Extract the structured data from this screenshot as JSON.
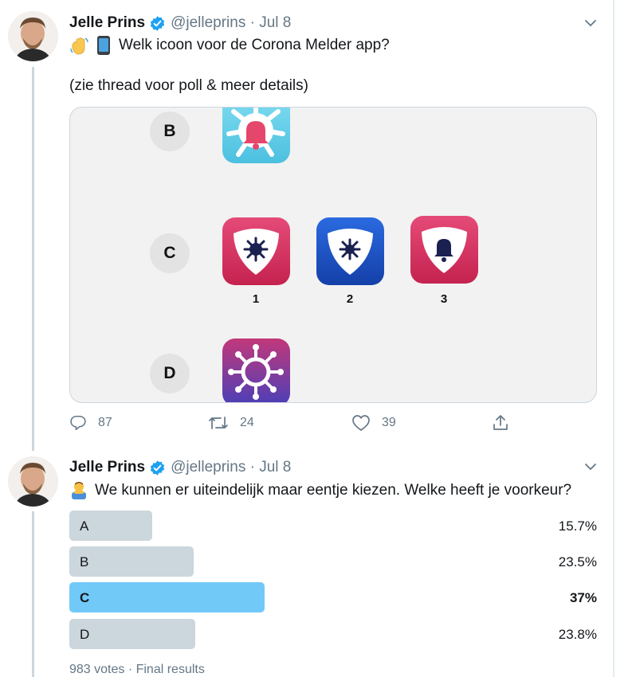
{
  "tweet1": {
    "author_name": "Jelle Prins",
    "handle": "@jelleprins",
    "date": "Jul 8",
    "text_line1": "Welk icoon voor de Corona Melder app?",
    "text_line2": "(zie thread voor poll & meer details)",
    "media": {
      "rows": [
        {
          "label": "B"
        },
        {
          "label": "C",
          "variants": [
            "1",
            "2",
            "3"
          ]
        },
        {
          "label": "D"
        }
      ]
    },
    "actions": {
      "replies": "87",
      "retweets": "24",
      "likes": "39"
    }
  },
  "tweet2": {
    "author_name": "Jelle Prins",
    "handle": "@jelleprins",
    "date": "Jul 8",
    "text": "We kunnen er uiteindelijk maar eentje kiezen. Welke heeft je voorkeur?",
    "poll": {
      "options": [
        {
          "label": "A",
          "percent_text": "15.7%",
          "percent": 15.7,
          "winner": false
        },
        {
          "label": "B",
          "percent_text": "23.5%",
          "percent": 23.5,
          "winner": false
        },
        {
          "label": "C",
          "percent_text": "37%",
          "percent": 37,
          "winner": true
        },
        {
          "label": "D",
          "percent_text": "23.8%",
          "percent": 23.8,
          "winner": false
        }
      ],
      "footer": "983 votes · Final results"
    }
  },
  "colors": {
    "verified": "#1da1f2",
    "poll_bar": "#ccd6dd",
    "poll_winner": "#71c9f8",
    "muted": "#657786",
    "icon_pink": "#d6336c",
    "icon_blue": "#1c4fb5",
    "icon_cyan": "#6fd1ea"
  }
}
